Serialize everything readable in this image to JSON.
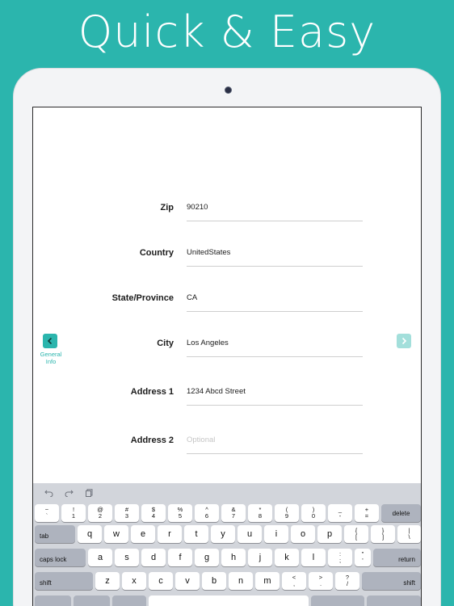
{
  "headline": "Quick & Easy",
  "form": {
    "fields": [
      {
        "label": "Zip",
        "value": "90210",
        "placeholder": ""
      },
      {
        "label": "Country",
        "value": "UnitedStates",
        "placeholder": ""
      },
      {
        "label": "State/Province",
        "value": "CA",
        "placeholder": ""
      },
      {
        "label": "City",
        "value": "Los Angeles",
        "placeholder": ""
      },
      {
        "label": "Address 1",
        "value": "1234 Abcd Street",
        "placeholder": ""
      },
      {
        "label": "Address 2",
        "value": "",
        "placeholder": "Optional"
      }
    ]
  },
  "nav": {
    "prev_label_line1": "General",
    "prev_label_line2": "Info",
    "accent_color": "#2bb5ad",
    "disabled_color": "#a3dfdb"
  },
  "keyboard": {
    "toolbar": [
      "undo-icon",
      "redo-icon",
      "paste-icon"
    ],
    "number_row": [
      {
        "top": "~",
        "bottom": "`"
      },
      {
        "top": "!",
        "bottom": "1"
      },
      {
        "top": "@",
        "bottom": "2"
      },
      {
        "top": "#",
        "bottom": "3"
      },
      {
        "top": "$",
        "bottom": "4"
      },
      {
        "top": "%",
        "bottom": "5"
      },
      {
        "top": "^",
        "bottom": "6"
      },
      {
        "top": "&",
        "bottom": "7"
      },
      {
        "top": "*",
        "bottom": "8"
      },
      {
        "top": "(",
        "bottom": "9"
      },
      {
        "top": ")",
        "bottom": "0"
      },
      {
        "top": "_",
        "bottom": "-"
      },
      {
        "top": "+",
        "bottom": "="
      }
    ],
    "delete_label": "delete",
    "tab_label": "tab",
    "row_q": [
      "q",
      "w",
      "e",
      "r",
      "t",
      "y",
      "u",
      "i",
      "o",
      "p"
    ],
    "row_q_extra": [
      {
        "top": "{",
        "bottom": "["
      },
      {
        "top": "}",
        "bottom": "]"
      },
      {
        "top": "|",
        "bottom": "\\"
      }
    ],
    "caps_label": "caps lock",
    "row_a": [
      "a",
      "s",
      "d",
      "f",
      "g",
      "h",
      "j",
      "k",
      "l"
    ],
    "row_a_extra": [
      {
        "top": ":",
        "bottom": ";"
      },
      {
        "top": "\"",
        "bottom": "'"
      }
    ],
    "return_label": "return",
    "shift_label": "shift",
    "row_z": [
      "z",
      "x",
      "c",
      "v",
      "b",
      "n",
      "m"
    ],
    "row_z_extra": [
      {
        "top": "<",
        "bottom": ","
      },
      {
        "top": ">",
        "bottom": "."
      },
      {
        "top": "?",
        "bottom": "/"
      }
    ],
    "colors": {
      "background": "#d2d5db",
      "key": "#ffffff",
      "special_key": "#aeb3be"
    }
  }
}
